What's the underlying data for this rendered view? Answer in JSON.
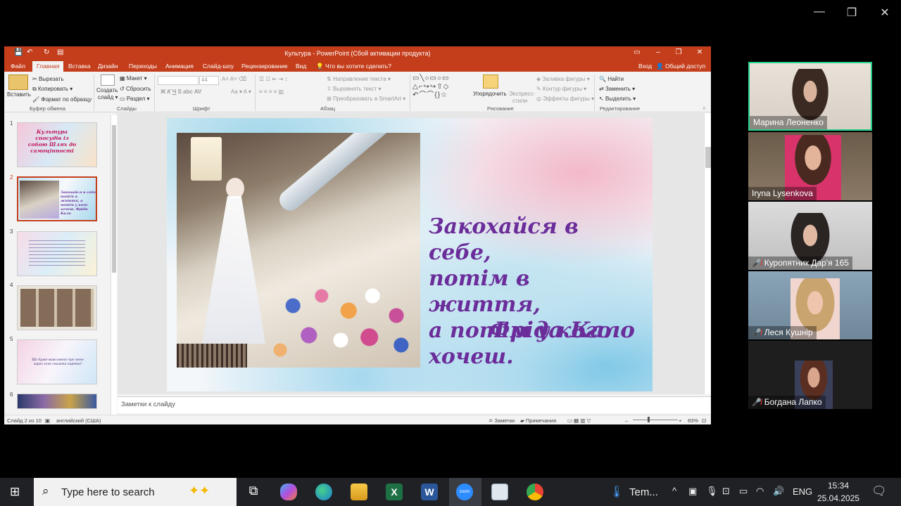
{
  "zoom_window": {
    "controls": {
      "minimize": "—",
      "restore": "❐",
      "close": "✕"
    }
  },
  "ppt": {
    "title": "Культура - PowerPoint (Сбой активации продукта)",
    "tabs": [
      "Файл",
      "Главная",
      "Вставка",
      "Дизайн",
      "Переходы",
      "Анимация",
      "Слайд-шоу",
      "Рецензирование",
      "Вид"
    ],
    "active_tab": "Главная",
    "tell_me": "Что вы хотите сделать?",
    "signin": "Вход",
    "share": "Общий доступ",
    "ribbon": {
      "clipboard": {
        "paste": "Вставить",
        "cut": "Вырезать",
        "copy": "Копировать",
        "format_painter": "Формат по образцу",
        "label": "Буфер обмена"
      },
      "slides": {
        "new_slide_1": "Создать",
        "new_slide_2": "слайд",
        "layout": "Макет",
        "reset": "Сбросить",
        "section": "Раздел",
        "label": "Слайды"
      },
      "font": {
        "size": "44",
        "label": "Шрифт"
      },
      "paragraph": {
        "text_direction": "Направление текста",
        "align_text": "Выровнять текст",
        "smartart": "Преобразовать в SmartArt",
        "label": "Абзац"
      },
      "drawing": {
        "arrange": "Упорядочить",
        "quick_styles_1": "Экспресс-",
        "quick_styles_2": "стили",
        "shape_fill": "Заливка фигуры",
        "shape_outline": "Контур фигуры",
        "shape_effects": "Эффекты фигуры",
        "label": "Рисование"
      },
      "editing": {
        "find": "Найти",
        "replace": "Заменить",
        "select": "Выделить",
        "label": "Редактирование"
      }
    },
    "thumbnails": [
      {
        "num": "1",
        "text": "Культура спосудів із собою Шлях до самоцінності"
      },
      {
        "num": "2",
        "text": "Закохайся в себе, потім в життя, а потім у кого хочеш. Фріда Кало"
      },
      {
        "num": "3",
        "text": ""
      },
      {
        "num": "4",
        "text": ""
      },
      {
        "num": "5",
        "text": "Що дуже важливого про мене зараз хоче сказати картка?"
      },
      {
        "num": "6",
        "text": ""
      }
    ],
    "slide": {
      "quote_lines": [
        "Закохайся в себе,",
        "потім в життя,",
        "а потім у кого",
        "хочеш."
      ],
      "author": "Фріда Кало"
    },
    "notes_placeholder": "Заметки к слайду",
    "status": {
      "slide_of": "Слайд 2 из 10",
      "language": "английский (США)",
      "notes": "Заметки",
      "comments": "Примечания",
      "zoom": "83%"
    }
  },
  "participants": [
    {
      "name": "Марина Леоненко",
      "muted": false,
      "active": true
    },
    {
      "name": "Iryna Lysenkova",
      "muted": false,
      "active": false
    },
    {
      "name": "Куропятник Дар'я 165",
      "muted": true,
      "active": false
    },
    {
      "name": "Леся Кушнір",
      "muted": true,
      "active": false
    },
    {
      "name": "Богдана Лапко",
      "muted": true,
      "active": false
    }
  ],
  "taskbar": {
    "search_placeholder": "Type here to search",
    "weather": "Tem...",
    "language": "ENG",
    "time": "15:34",
    "date": "25.04.2025"
  }
}
